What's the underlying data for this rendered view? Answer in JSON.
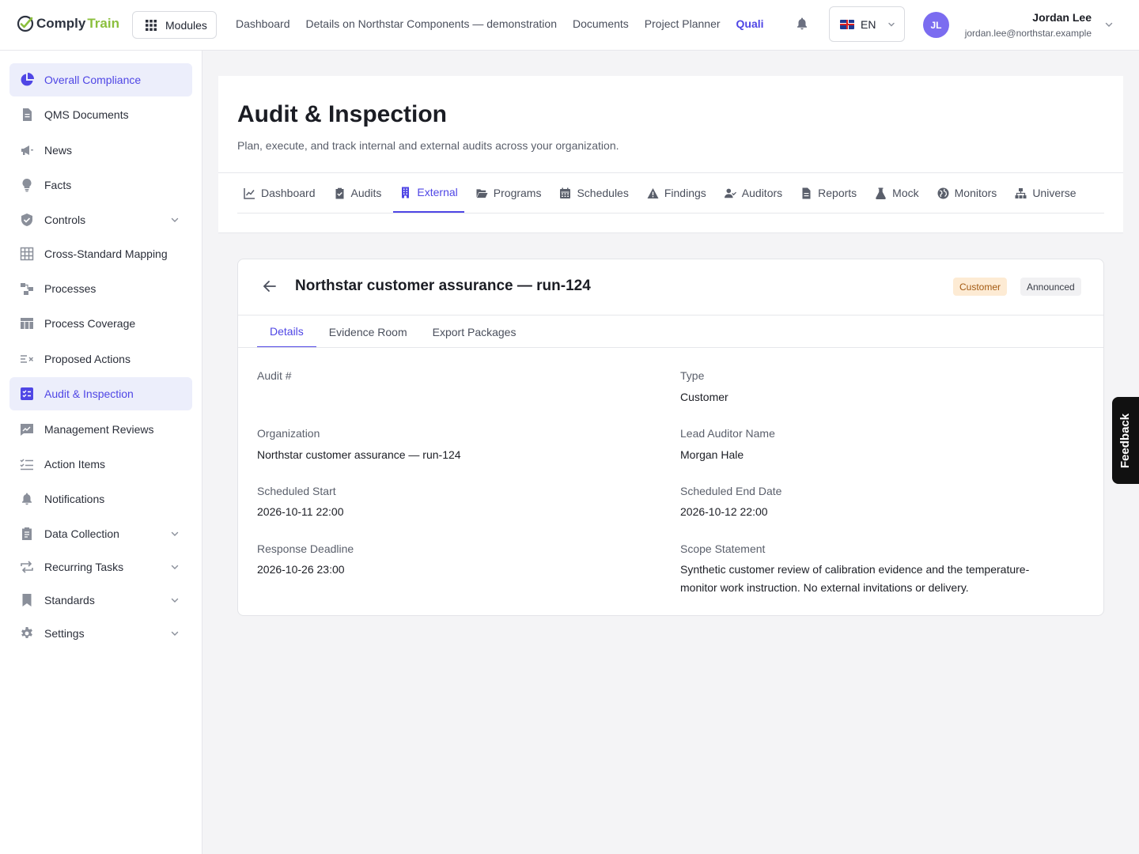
{
  "brand": {
    "name_part1": "Comply",
    "name_part2": "Train",
    "accent": "#8bbf3d"
  },
  "topbar": {
    "modules_label": "Modules",
    "nav": [
      "Dashboard",
      "Details on Northstar Components — demonstration",
      "Documents",
      "Project Planner",
      "Quali"
    ],
    "active_nav": "Quali",
    "language": "EN",
    "user": {
      "initials": "JL",
      "name": "Jordan Lee",
      "email": "jordan.lee@northstar.example"
    }
  },
  "sidebar": {
    "items": [
      {
        "label": "Overall Compliance",
        "icon": "pie-chart-icon",
        "active": true
      },
      {
        "label": "QMS Documents",
        "icon": "document-icon"
      },
      {
        "label": "News",
        "icon": "megaphone-icon"
      },
      {
        "label": "Facts",
        "icon": "lightbulb-icon"
      },
      {
        "label": "Controls",
        "icon": "shield-check-icon",
        "expandable": true
      },
      {
        "label": "Cross-Standard Mapping",
        "icon": "grid-icon"
      },
      {
        "label": "Processes",
        "icon": "process-flow-icon"
      },
      {
        "label": "Process Coverage",
        "icon": "table-icon"
      },
      {
        "label": "Proposed Actions",
        "icon": "list-x-icon"
      },
      {
        "label": "Audit & Inspection",
        "icon": "checklist-icon",
        "active": true
      },
      {
        "label": "Management Reviews",
        "icon": "chart-board-icon"
      },
      {
        "label": "Action Items",
        "icon": "list-check-icon"
      },
      {
        "label": "Notifications",
        "icon": "bell-icon"
      },
      {
        "label": "Data Collection",
        "icon": "clipboard-icon",
        "expandable": true
      },
      {
        "label": "Recurring Tasks",
        "icon": "repeat-icon",
        "expandable": true
      },
      {
        "label": "Standards",
        "icon": "bookmark-icon",
        "expandable": true
      },
      {
        "label": "Settings",
        "icon": "gear-icon",
        "expandable": true
      }
    ]
  },
  "page": {
    "title": "Audit & Inspection",
    "subtitle": "Plan, execute, and track internal and external audits across your organization.",
    "tabs": [
      {
        "label": "Dashboard",
        "icon": "line-chart-icon"
      },
      {
        "label": "Audits",
        "icon": "clipboard-check-icon"
      },
      {
        "label": "External",
        "icon": "building-icon",
        "active": true
      },
      {
        "label": "Programs",
        "icon": "folder-open-icon"
      },
      {
        "label": "Schedules",
        "icon": "calendar-icon"
      },
      {
        "label": "Findings",
        "icon": "warning-icon"
      },
      {
        "label": "Auditors",
        "icon": "user-check-icon"
      },
      {
        "label": "Reports",
        "icon": "file-icon"
      },
      {
        "label": "Mock",
        "icon": "flask-icon"
      },
      {
        "label": "Monitors",
        "icon": "globe-icon"
      },
      {
        "label": "Universe",
        "icon": "sitemap-icon"
      }
    ]
  },
  "audit": {
    "title": "Northstar customer assurance — run-124",
    "badges": {
      "type": "Customer",
      "status": "Announced"
    },
    "subtabs": [
      "Details",
      "Evidence Room",
      "Export Packages"
    ],
    "active_subtab": "Details",
    "fields": {
      "audit_no": {
        "label": "Audit #",
        "value": ""
      },
      "type": {
        "label": "Type",
        "value": "Customer"
      },
      "organization": {
        "label": "Organization",
        "value": "Northstar customer assurance — run-124"
      },
      "lead_auditor": {
        "label": "Lead Auditor Name",
        "value": "Morgan Hale"
      },
      "scheduled_start": {
        "label": "Scheduled Start",
        "value": "2026-10-11 22:00"
      },
      "scheduled_end": {
        "label": "Scheduled End Date",
        "value": "2026-10-12 22:00"
      },
      "response_deadline": {
        "label": "Response Deadline",
        "value": "2026-10-26 23:00"
      },
      "scope": {
        "label": "Scope Statement",
        "value": "Synthetic customer review of calibration evidence and the temperature-monitor work instruction. No external invitations or delivery."
      }
    }
  },
  "feedback_label": "Feedback"
}
